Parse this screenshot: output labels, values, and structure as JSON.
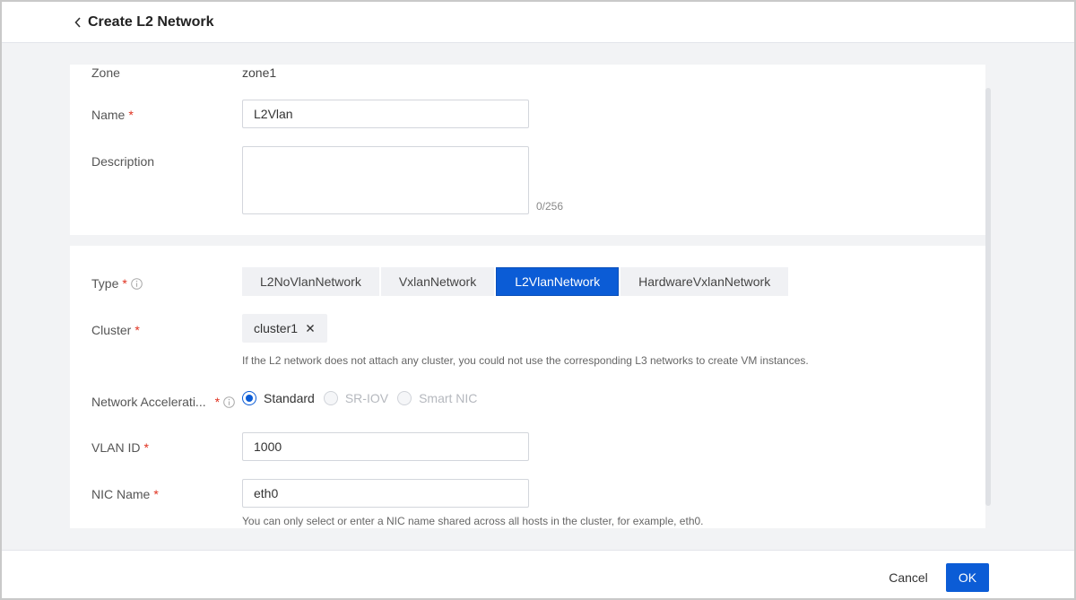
{
  "header": {
    "title": "Create L2 Network"
  },
  "form": {
    "zone": {
      "label": "Zone",
      "value": "zone1"
    },
    "name": {
      "label": "Name",
      "required": "*",
      "value": "L2Vlan"
    },
    "description": {
      "label": "Description",
      "value": "",
      "counter": "0/256"
    },
    "type": {
      "label": "Type",
      "required": "*",
      "options": [
        "L2NoVlanNetwork",
        "VxlanNetwork",
        "L2VlanNetwork",
        "HardwareVxlanNetwork"
      ],
      "selected": "L2VlanNetwork"
    },
    "cluster": {
      "label": "Cluster",
      "required": "*",
      "tag": "cluster1",
      "hint": "If the L2 network does not attach any cluster, you could not use the corresponding L3 networks to create VM instances."
    },
    "acceleration": {
      "label": "Network Accelerati...",
      "required": "*",
      "options": [
        "Standard",
        "SR-IOV",
        "Smart NIC"
      ],
      "selected": "Standard"
    },
    "vlan_id": {
      "label": "VLAN ID",
      "required": "*",
      "value": "1000"
    },
    "nic_name": {
      "label": "NIC Name",
      "required": "*",
      "value": "eth0",
      "hint": "You can only select or enter a NIC name shared across all hosts in the cluster, for example, eth0."
    }
  },
  "footer": {
    "cancel_label": "Cancel",
    "ok_label": "OK"
  },
  "colors": {
    "primary": "#0b5cd6",
    "required": "#e0301e",
    "page_bg": "#f2f3f5"
  }
}
